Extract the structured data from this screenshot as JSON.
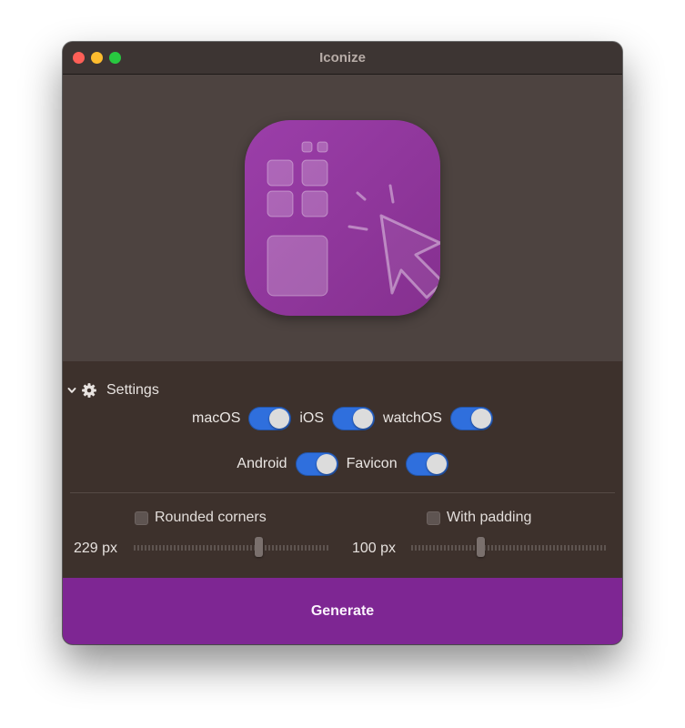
{
  "window": {
    "title": "Iconize"
  },
  "settings": {
    "title": "Settings",
    "platforms": [
      {
        "label": "macOS",
        "enabled": true
      },
      {
        "label": "iOS",
        "enabled": true
      },
      {
        "label": "watchOS",
        "enabled": true
      },
      {
        "label": "Android",
        "enabled": true
      },
      {
        "label": "Favicon",
        "enabled": true
      }
    ],
    "rounded_corners": {
      "label": "Rounded corners",
      "checked": false,
      "value_label": "229 px",
      "slider_fraction": 0.65
    },
    "with_padding": {
      "label": "With padding",
      "checked": false,
      "value_label": "100 px",
      "slider_fraction": 0.35
    }
  },
  "generate_label": "Generate",
  "icons": {
    "disclosure": "chevron-down-icon",
    "settings": "gear-icon"
  },
  "colors": {
    "accent": "#7e2693",
    "toggle_on": "#2f6fdd",
    "icon_gradient_start": "#9b3ea9",
    "icon_gradient_end": "#85308f"
  }
}
